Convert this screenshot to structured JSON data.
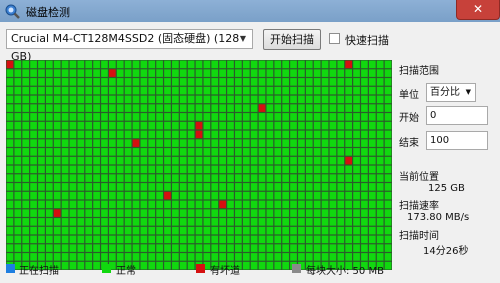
{
  "window": {
    "title": "磁盘检测",
    "close_symbol": "✕"
  },
  "toolbar": {
    "drive_value": "Crucial M4-CT128M4SSD2 (固态硬盘)  (128 GB)",
    "start_label": "开始扫描",
    "fast_scan_label": "快速扫描",
    "fast_scan_checked": false
  },
  "panel": {
    "range_heading": "扫描范围",
    "unit_label": "单位",
    "unit_value": "百分比",
    "start_label": "开始",
    "start_value": "0",
    "end_label": "结束",
    "end_value": "100",
    "position_label": "当前位置",
    "position_value": "125 GB",
    "speed_label": "扫描速率",
    "speed_value": "173.80 MB/s",
    "time_label": "扫描时间",
    "time_value": "14分26秒"
  },
  "legend": {
    "scanning": "正在扫描",
    "normal": "正常",
    "bad": "有坏道",
    "block_size": "每块大小:   50 MB"
  },
  "colors": {
    "scanning": "#1e7ee0",
    "normal": "#11d80f",
    "bad": "#d51010",
    "block_size": "#8a8a8a",
    "grid_line": "#2b5b2b"
  },
  "grid": {
    "columns": 49,
    "rows": 24,
    "bad_blocks": [
      {
        "row": 0,
        "col": 0
      },
      {
        "row": 0,
        "col": 43
      },
      {
        "row": 1,
        "col": 13
      },
      {
        "row": 5,
        "col": 32
      },
      {
        "row": 7,
        "col": 24
      },
      {
        "row": 8,
        "col": 24
      },
      {
        "row": 9,
        "col": 16
      },
      {
        "row": 11,
        "col": 43
      },
      {
        "row": 15,
        "col": 20
      },
      {
        "row": 16,
        "col": 27
      },
      {
        "row": 17,
        "col": 6
      }
    ]
  }
}
